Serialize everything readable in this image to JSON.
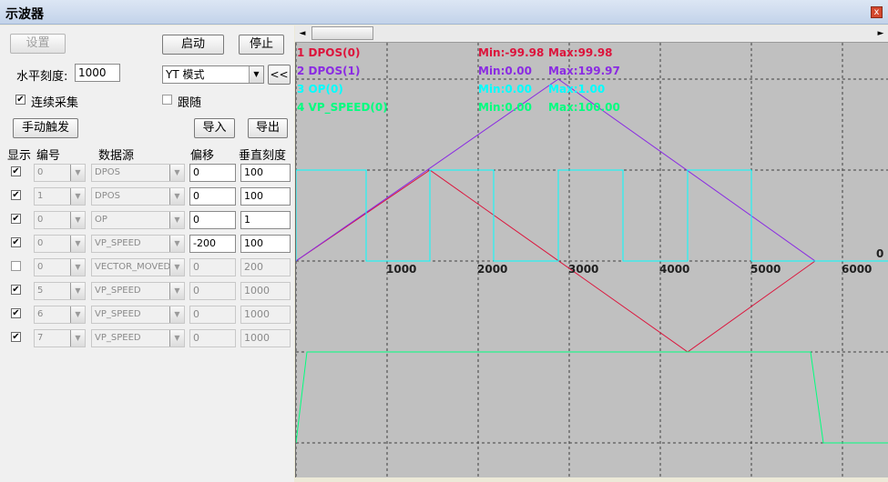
{
  "window": {
    "title": "示波器",
    "close_glyph": "x"
  },
  "controls": {
    "settings": "设置",
    "start": "启动",
    "stop": "停止",
    "h_scale_label": "水平刻度:",
    "h_scale_value": "1000",
    "mode_value": "YT 模式",
    "collapse": "<<",
    "continuous_label": "连续采集",
    "continuous_checked": true,
    "follow_label": "跟随",
    "follow_checked": false,
    "manual_trigger": "手动触发",
    "import": "导入",
    "export": "导出"
  },
  "table": {
    "headers": [
      "显示",
      "编号",
      "数据源",
      "偏移",
      "垂直刻度"
    ],
    "rows": [
      {
        "show": true,
        "index": "0",
        "source": "DPOS",
        "offset": "0",
        "scale": "100",
        "enabled": true
      },
      {
        "show": true,
        "index": "1",
        "source": "DPOS",
        "offset": "0",
        "scale": "100",
        "enabled": true
      },
      {
        "show": true,
        "index": "0",
        "source": "OP",
        "offset": "0",
        "scale": "1",
        "enabled": true
      },
      {
        "show": true,
        "index": "0",
        "source": "VP_SPEED",
        "offset": "-200",
        "scale": "100",
        "enabled": true
      },
      {
        "show": false,
        "index": "0",
        "source": "VECTOR_MOVED",
        "offset": "0",
        "scale": "200",
        "enabled": false
      },
      {
        "show": true,
        "index": "5",
        "source": "VP_SPEED",
        "offset": "0",
        "scale": "1000",
        "enabled": false
      },
      {
        "show": true,
        "index": "6",
        "source": "VP_SPEED",
        "offset": "0",
        "scale": "1000",
        "enabled": false
      },
      {
        "show": true,
        "index": "7",
        "source": "VP_SPEED",
        "offset": "0",
        "scale": "1000",
        "enabled": false
      }
    ]
  },
  "scrollbar": {
    "left_arrow": "◄",
    "right_arrow": "►"
  },
  "scope": {
    "background": "#c0c0c0",
    "grid_color": "#404040",
    "x_ticks": [
      "1000",
      "2000",
      "3000",
      "4000",
      "5000",
      "6000"
    ],
    "x_range": [
      0,
      6500
    ],
    "zero_label": "0",
    "legend": [
      {
        "name": "1 DPOS(0)",
        "min": "Min:-99.98",
        "max": "Max:99.98",
        "color": "#dc143c"
      },
      {
        "name": "2 DPOS(1)",
        "min": "Min:0.00",
        "max": "Max:199.97",
        "color": "#8a2be2"
      },
      {
        "name": "3 OP(0)",
        "min": "Min:0.00",
        "max": "Max:1.00",
        "color": "#00ffff"
      },
      {
        "name": "4 VP_SPEED(0)",
        "min": "Min:0.00",
        "max": "Max:100.00",
        "color": "#00ff7f"
      }
    ]
  },
  "chart_data": {
    "type": "line",
    "x_range": [
      0,
      6500
    ],
    "series": [
      {
        "name": "1 DPOS(0)",
        "color": "#dc143c",
        "x": [
          0,
          1470,
          4300,
          5700
        ],
        "y": [
          0,
          99.98,
          -99.98,
          0
        ]
      },
      {
        "name": "2 DPOS(1)",
        "color": "#8a2be2",
        "x": [
          0,
          2880,
          5700
        ],
        "y": [
          0,
          199.97,
          0
        ]
      },
      {
        "name": "3 OP(0)",
        "color": "#00ffff",
        "x": [
          0,
          0,
          770,
          770,
          1470,
          1470,
          2170,
          2170,
          2880,
          2880,
          3590,
          3590,
          4300,
          4300,
          5000,
          5000,
          6500
        ],
        "y": [
          0,
          1,
          1,
          0,
          0,
          1,
          1,
          0,
          0,
          1,
          1,
          0,
          0,
          1,
          1,
          0,
          0
        ]
      },
      {
        "name": "4 VP_SPEED(0)",
        "color": "#00ff7f",
        "x": [
          0,
          120,
          5650,
          5790,
          6500
        ],
        "y": [
          0,
          100,
          100,
          0,
          0
        ]
      }
    ]
  }
}
